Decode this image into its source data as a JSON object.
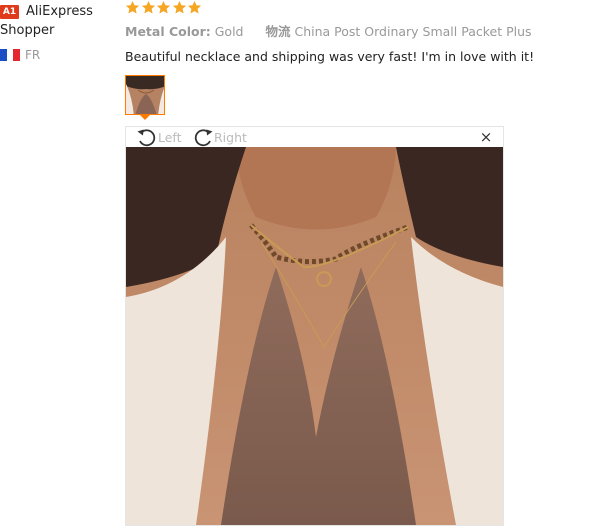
{
  "reviewer": {
    "level_badge": "A1",
    "name": "AliExpress Shopper",
    "country_code": "FR",
    "flag_colors": [
      "#1a4fc4",
      "#ffffff",
      "#e4262f"
    ]
  },
  "review": {
    "rating": 5,
    "star_color": "#f5a623",
    "attributes": [
      {
        "label": "Metal Color:",
        "value": "Gold"
      },
      {
        "label": "物流",
        "value": "China Post Ordinary Small Packet Plus"
      }
    ],
    "feedback": "Beautiful necklace and shipping was very fast! I'm in love with it!"
  },
  "viewer": {
    "rotate_left_label": "Left",
    "rotate_right_label": "Right",
    "close_glyph": "×",
    "accent_color": "#ff7b00"
  }
}
